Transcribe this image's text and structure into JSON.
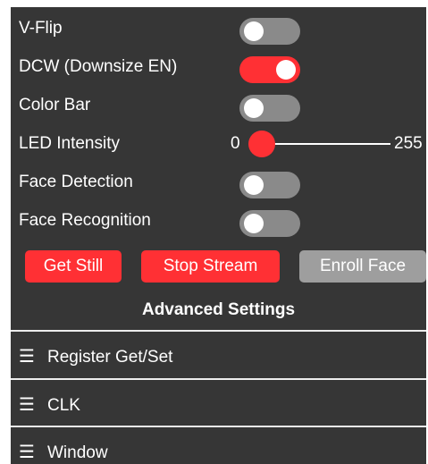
{
  "settings": {
    "vflip": {
      "label": "V-Flip",
      "enabled": false
    },
    "dcw": {
      "label": "DCW (Downsize EN)",
      "enabled": true
    },
    "colorbar": {
      "label": "Color Bar",
      "enabled": false
    },
    "led": {
      "label": "LED Intensity",
      "min": "0",
      "max": "255",
      "value": 0
    },
    "face_detect": {
      "label": "Face Detection",
      "enabled": false
    },
    "face_recognize": {
      "label": "Face Recognition",
      "enabled": false
    }
  },
  "buttons": {
    "get_still": "Get Still",
    "stop_stream": "Stop Stream",
    "enroll_face": "Enroll Face"
  },
  "advanced": {
    "title": "Advanced Settings",
    "items": [
      {
        "icon": "menu-icon",
        "glyph": "☰",
        "label": "Register Get/Set"
      },
      {
        "icon": "menu-icon",
        "glyph": "☰",
        "label": "CLK"
      },
      {
        "icon": "menu-icon",
        "glyph": "☰",
        "label": "Window"
      }
    ]
  },
  "colors": {
    "panel": "#363636",
    "accent": "#ff3034",
    "toggle_off": "#8a8a8a",
    "disabled_button": "#9e9e9e"
  }
}
